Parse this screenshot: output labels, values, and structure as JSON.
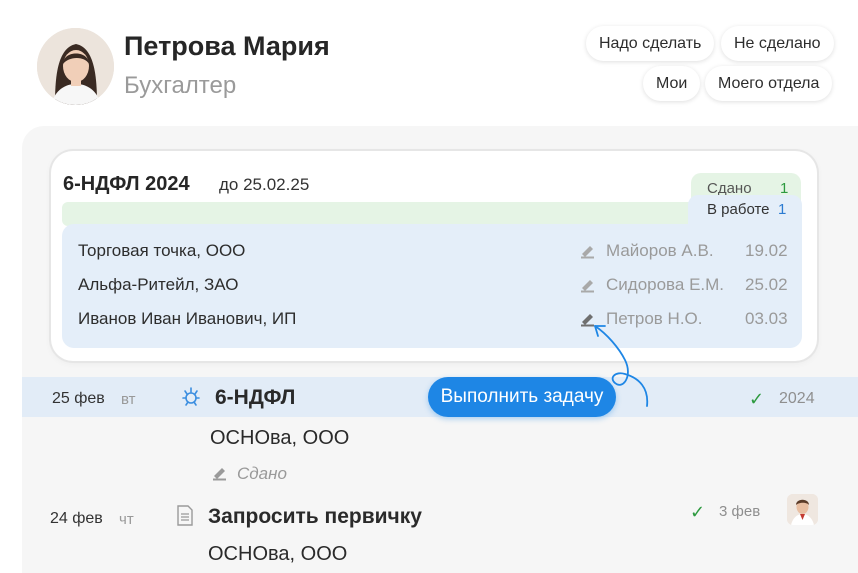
{
  "user": {
    "name": "Петрова Мария",
    "role": "Бухгалтер"
  },
  "filters": [
    "Надо сделать",
    "Не сделано",
    "Мои",
    "Моего отдела"
  ],
  "report": {
    "title": "6-НДФЛ 2024",
    "deadline": "до 25.02.25",
    "done_label": "Сдано",
    "done_count": "1",
    "in_work_label": "В работе",
    "in_work_count": "1",
    "rows": [
      {
        "org": "Торговая точка, ООО",
        "person": "Майоров А.В.",
        "date": "19.02"
      },
      {
        "org": "Альфа-Ритейл, ЗАО",
        "person": "Сидорова Е.М.",
        "date": "25.02"
      },
      {
        "org": "Иванов Иван Иванович, ИП",
        "person": "Петров Н.О.",
        "date": "03.03"
      }
    ]
  },
  "tasks": [
    {
      "day": "25 фев",
      "dow": "вт",
      "title": "6-НДФЛ",
      "org": "ОСНОва, ООО",
      "status": "Сдано",
      "year": "2024",
      "icon": "tax-icon"
    },
    {
      "day": "24 фев",
      "dow": "чт",
      "title": "Запросить первичку",
      "org": "ОСНОва, ООО",
      "when": "3 фев",
      "icon": "document-icon"
    }
  ],
  "action_button": "Выполнить задачу",
  "colors": {
    "accent": "#1e86e5",
    "done": "#2d9a3f",
    "in_work_bg": "#e4eef9",
    "done_bg": "#e5f4e5"
  }
}
